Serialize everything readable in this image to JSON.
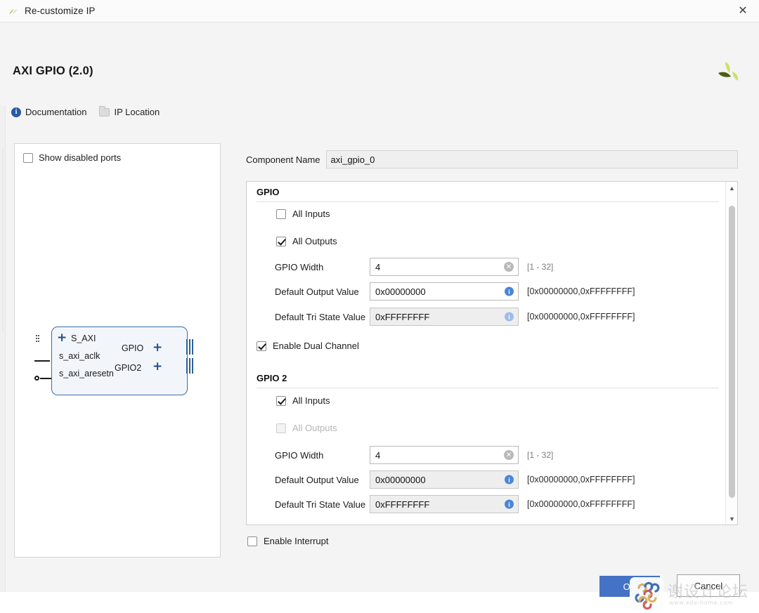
{
  "window": {
    "title": "Re-customize IP",
    "app_icon": "vivado-leaf-icon",
    "close_label": "✕"
  },
  "header": {
    "ip_title": "AXI GPIO (2.0)",
    "brand_icon": "xilinx-leaf-logo",
    "links": [
      {
        "label": "Documentation",
        "icon": "info-icon"
      },
      {
        "label": "IP Location",
        "icon": "folder-icon"
      }
    ]
  },
  "port_panel": {
    "show_disabled_ports": {
      "label": "Show disabled ports",
      "checked": false
    },
    "block": {
      "left_ports": [
        "S_AXI",
        "s_axi_aclk",
        "s_axi_aresetn"
      ],
      "right_ports": [
        "GPIO",
        "GPIO2"
      ]
    }
  },
  "component": {
    "label": "Component Name",
    "value": "axi_gpio_0"
  },
  "gpio": {
    "group_title": "GPIO",
    "all_inputs": {
      "label": "All Inputs",
      "checked": false,
      "disabled": false
    },
    "all_outputs": {
      "label": "All Outputs",
      "checked": true,
      "disabled": false
    },
    "width": {
      "label": "GPIO Width",
      "value": "4",
      "hint": "[1 - 32]",
      "icon": "clear-icon"
    },
    "default_output": {
      "label": "Default Output Value",
      "value": "0x00000000",
      "hint": "[0x00000000,0xFFFFFFFF]",
      "icon": "info-icon"
    },
    "default_tristate": {
      "label": "Default Tri State Value",
      "value": "0xFFFFFFFF",
      "hint": "[0x00000000,0xFFFFFFFF]",
      "icon": "info-icon"
    }
  },
  "dual_channel": {
    "label": "Enable Dual Channel",
    "checked": true
  },
  "gpio2": {
    "group_title": "GPIO 2",
    "all_inputs": {
      "label": "All Inputs",
      "checked": true,
      "disabled": false
    },
    "all_outputs": {
      "label": "All Outputs",
      "checked": false,
      "disabled": true
    },
    "width": {
      "label": "GPIO Width",
      "value": "4",
      "hint": "[1 - 32]",
      "icon": "clear-icon"
    },
    "default_output": {
      "label": "Default Output Value",
      "value": "0x00000000",
      "hint": "[0x00000000,0xFFFFFFFF]",
      "icon": "info-icon"
    },
    "default_tristate": {
      "label": "Default Tri State Value",
      "value": "0xFFFFFFFF",
      "hint": "[0x00000000,0xFFFFFFFF]",
      "icon": "info-icon"
    }
  },
  "interrupt": {
    "label": "Enable Interrupt",
    "checked": false
  },
  "footer": {
    "ok_label": "OK",
    "cancel_label": "Cancel"
  },
  "watermark": {
    "text": "谢设计论坛",
    "subtext": "www.eda-home.com",
    "logo": "chain-links-logo"
  },
  "colors": {
    "accent": "#4472c4",
    "info": "#4a86d8",
    "block_border": "#3a6ea5",
    "brand_green": "#a6ce39"
  }
}
